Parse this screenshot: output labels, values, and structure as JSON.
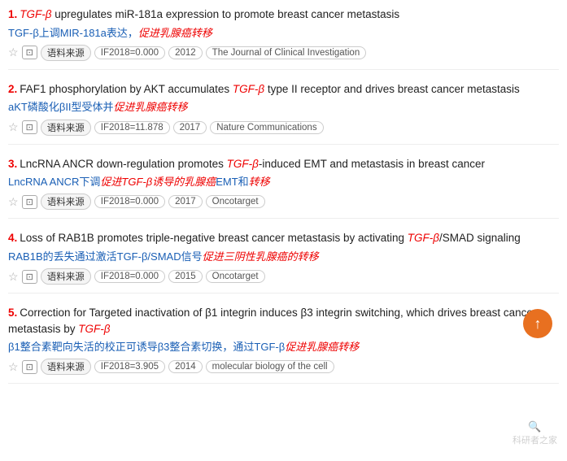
{
  "results": [
    {
      "number": "1.",
      "title_parts": [
        {
          "text": "TGF-β",
          "type": "italic-red"
        },
        {
          "text": " upregulates miR-181a expression to promote breast cancer metastasis",
          "type": "normal"
        }
      ],
      "chinese_parts": [
        {
          "text": "TGF-β上调MIR-181a表达，",
          "type": "normal"
        },
        {
          "text": "促进乳腺癌转移",
          "type": "italic-red"
        }
      ],
      "if": "IF2018=0.000",
      "year": "2012",
      "journal": "The Journal of Clinical Investigation"
    },
    {
      "number": "2.",
      "title_parts": [
        {
          "text": "FAF1 phosphorylation by AKT accumulates ",
          "type": "normal"
        },
        {
          "text": "TGF-β",
          "type": "italic-red"
        },
        {
          "text": " type II receptor and drives breast cancer metastasis",
          "type": "normal"
        }
      ],
      "chinese_parts": [
        {
          "text": "aKT磷酸化βII型受体并",
          "type": "normal"
        },
        {
          "text": "促进乳腺癌转移",
          "type": "italic-red"
        }
      ],
      "if": "IF2018=11.878",
      "year": "2017",
      "journal": "Nature Communications"
    },
    {
      "number": "3.",
      "title_parts": [
        {
          "text": "LncRNA ANCR down-regulation promotes ",
          "type": "normal"
        },
        {
          "text": "TGF-β",
          "type": "italic-red"
        },
        {
          "text": "-induced EMT and metastasis in breast cancer",
          "type": "normal"
        }
      ],
      "chinese_parts": [
        {
          "text": "LncRNA ANCR下调",
          "type": "normal"
        },
        {
          "text": "促进TGF-β诱导的",
          "type": "italic-red"
        },
        {
          "text": "乳腺癌",
          "type": "italic-red"
        },
        {
          "text": "EMT和",
          "type": "normal"
        },
        {
          "text": "转移",
          "type": "italic-red"
        }
      ],
      "if": "IF2018=0.000",
      "year": "2017",
      "journal": "Oncotarget"
    },
    {
      "number": "4.",
      "title_parts": [
        {
          "text": "Loss of RAB1B promotes triple-negative breast cancer metastasis by activating ",
          "type": "normal"
        },
        {
          "text": "TGF-β",
          "type": "italic-red"
        },
        {
          "text": "/SMAD signaling",
          "type": "normal"
        }
      ],
      "chinese_parts": [
        {
          "text": "RAB1B的丢失通过激活TGF-β/SMAD信号",
          "type": "normal"
        },
        {
          "text": "促进三阴性乳腺癌的",
          "type": "italic-red"
        },
        {
          "text": "转移",
          "type": "italic-red"
        }
      ],
      "if": "IF2018=0.000",
      "year": "2015",
      "journal": "Oncotarget"
    },
    {
      "number": "5.",
      "title_parts": [
        {
          "text": "Correction for Targeted inactivation of β1 integrin induces β3 integrin switching, which drives breast cancer metastasis by ",
          "type": "normal"
        },
        {
          "text": "TGF-β",
          "type": "italic-red"
        }
      ],
      "chinese_parts": [
        {
          "text": "β1整合素靶向失活的校正可诱导β3整合素切换，通过TGF-β",
          "type": "normal"
        },
        {
          "text": "促进乳腺癌转移",
          "type": "italic-red"
        }
      ],
      "if": "IF2018=3.905",
      "year": "2014",
      "journal": "molecular biology of the cell"
    }
  ],
  "labels": {
    "source": "语料来源",
    "scroll_up": "↑",
    "watermark": "科研者之家"
  }
}
